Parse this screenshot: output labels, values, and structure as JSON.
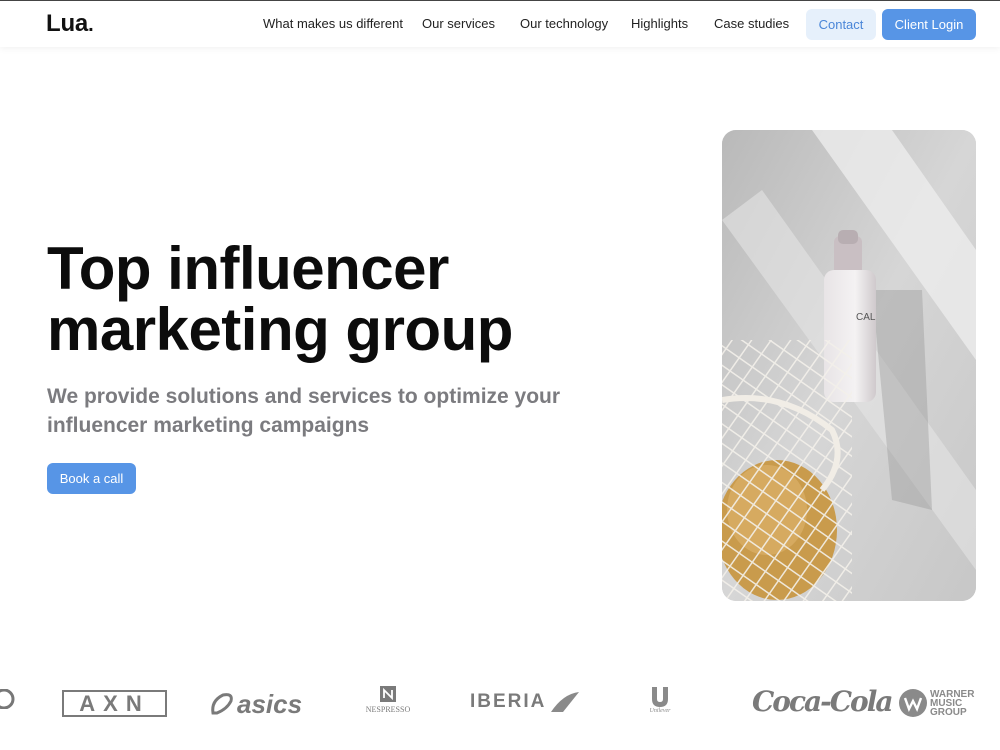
{
  "header": {
    "logo": "Lua",
    "logo_dot": ".",
    "nav": [
      {
        "label": "What makes us different"
      },
      {
        "label": "Our services"
      },
      {
        "label": "Our technology"
      },
      {
        "label": "Highlights"
      },
      {
        "label": "Case studies"
      }
    ],
    "contact_label": "Contact",
    "login_label": "Client Login"
  },
  "hero": {
    "title_line1": "Top influencer",
    "title_line2": "marketing group",
    "subtitle": "We provide solutions and services to optimize your influencer marketing campaigns",
    "cta_label": "Book a call",
    "image": "product-bottle-photo"
  },
  "brands": [
    {
      "name": "AXN"
    },
    {
      "name": "asics"
    },
    {
      "name": "NESPRESSO"
    },
    {
      "name": "IBERIA"
    },
    {
      "name": "Unilever"
    },
    {
      "name": "Coca-Cola"
    },
    {
      "name": "WARNER MUSIC GROUP",
      "lines": [
        "WARNER",
        "MUSIC",
        "GROUP"
      ]
    }
  ],
  "colors": {
    "accent": "#5795e6",
    "accent_light": "#e6f0fb",
    "subtitle_gray": "#7b7b7f",
    "brand_gray": "#7a7a7a"
  }
}
